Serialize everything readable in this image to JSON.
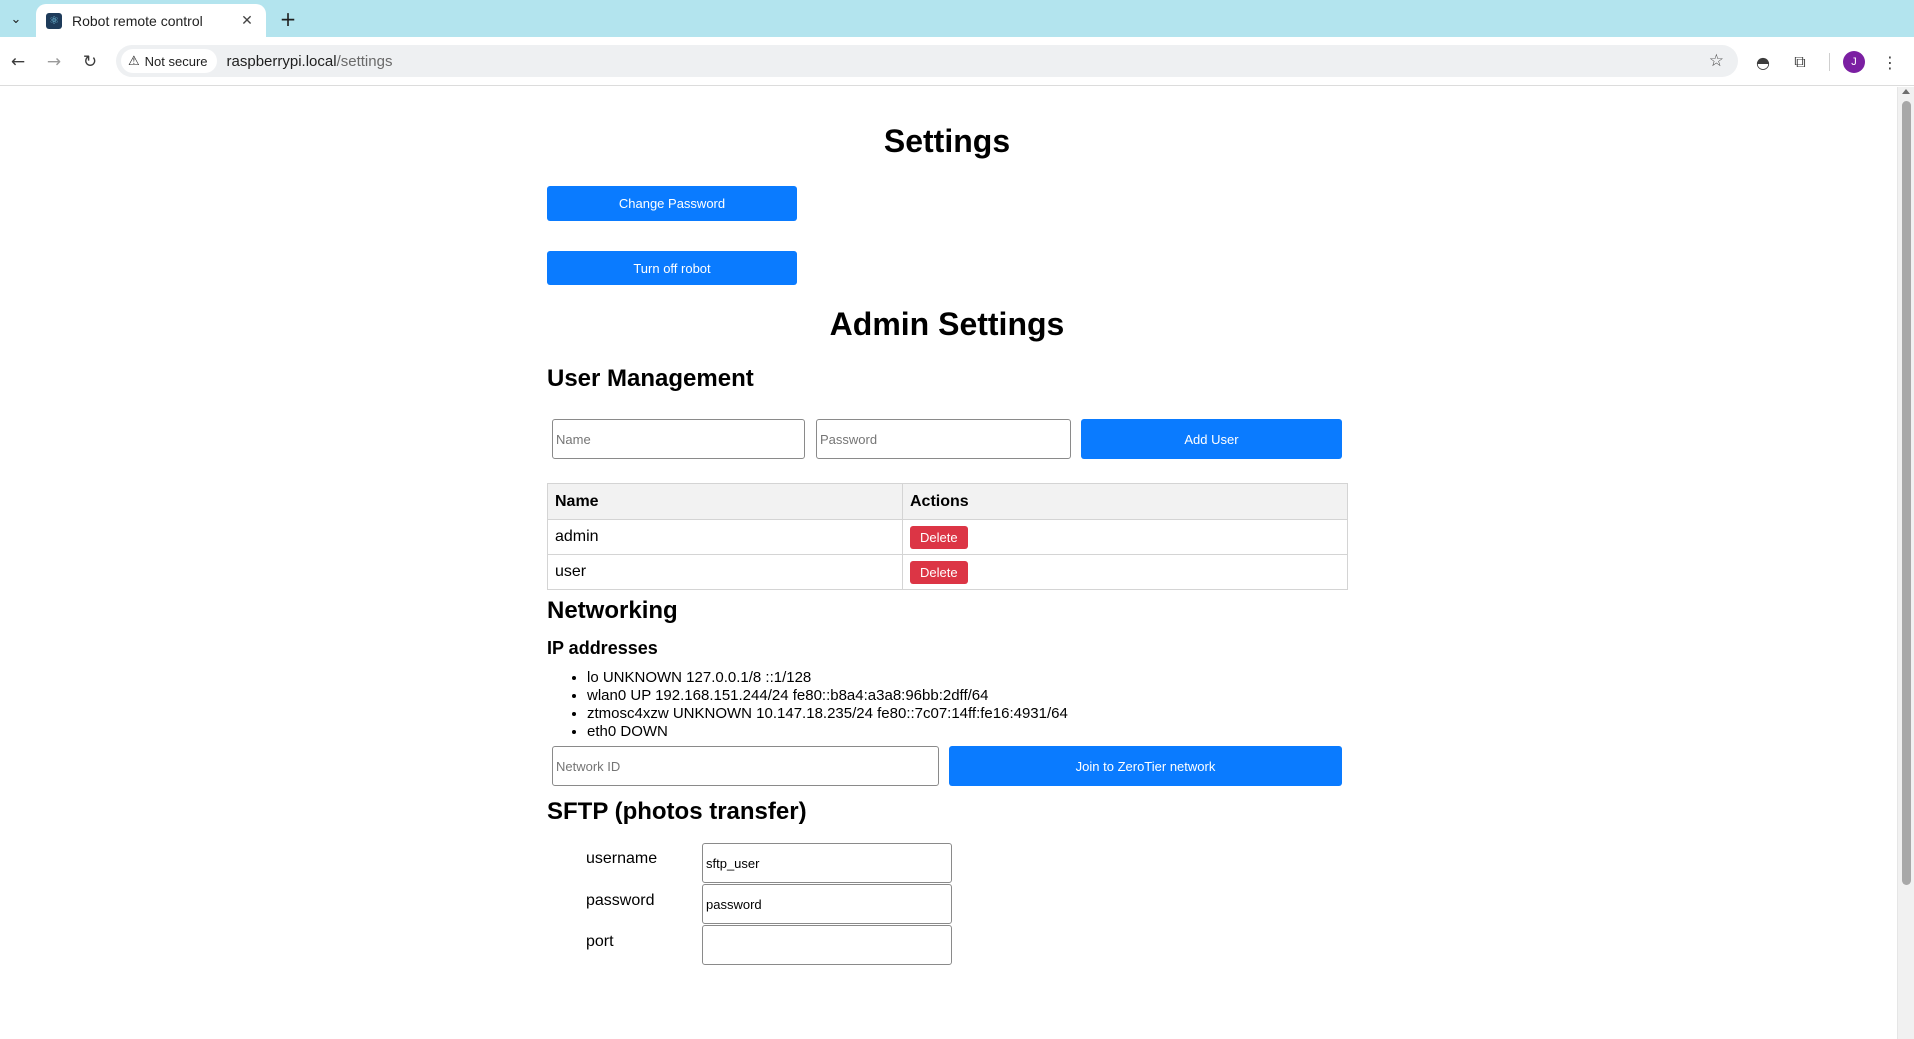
{
  "browser": {
    "tab_title": "Robot remote control",
    "security_label": "Not secure",
    "url_host": "raspberrypi.local",
    "url_path": "/settings",
    "profile_initial": "J"
  },
  "page": {
    "title": "Settings",
    "change_password_label": "Change Password",
    "turn_off_label": "Turn off robot",
    "admin_title": "Admin Settings"
  },
  "user_management": {
    "heading": "User Management",
    "name_placeholder": "Name",
    "password_placeholder": "Password",
    "add_user_label": "Add User",
    "columns": [
      "Name",
      "Actions"
    ],
    "rows": [
      {
        "name": "admin",
        "action": "Delete"
      },
      {
        "name": "user",
        "action": "Delete"
      }
    ]
  },
  "networking": {
    "heading": "Networking",
    "ip_heading": "IP addresses",
    "ip_items": [
      "lo UNKNOWN 127.0.0.1/8 ::1/128",
      "wlan0 UP 192.168.151.244/24 fe80::b8a4:a3a8:96bb:2dff/64",
      "ztmosc4xzw UNKNOWN 10.147.18.235/24 fe80::7c07:14ff:fe16:4931/64",
      "eth0 DOWN"
    ],
    "network_id_placeholder": "Network ID",
    "join_label": "Join to ZeroTier network"
  },
  "sftp": {
    "heading": "SFTP (photos transfer)",
    "username_label": "username",
    "username_value": "sftp_user",
    "password_label": "password",
    "password_value": "password",
    "third_label_partial": "port"
  },
  "colors": {
    "primary": "#0a7bff",
    "danger": "#dc3545",
    "tabbar": "#b3e4ee"
  }
}
